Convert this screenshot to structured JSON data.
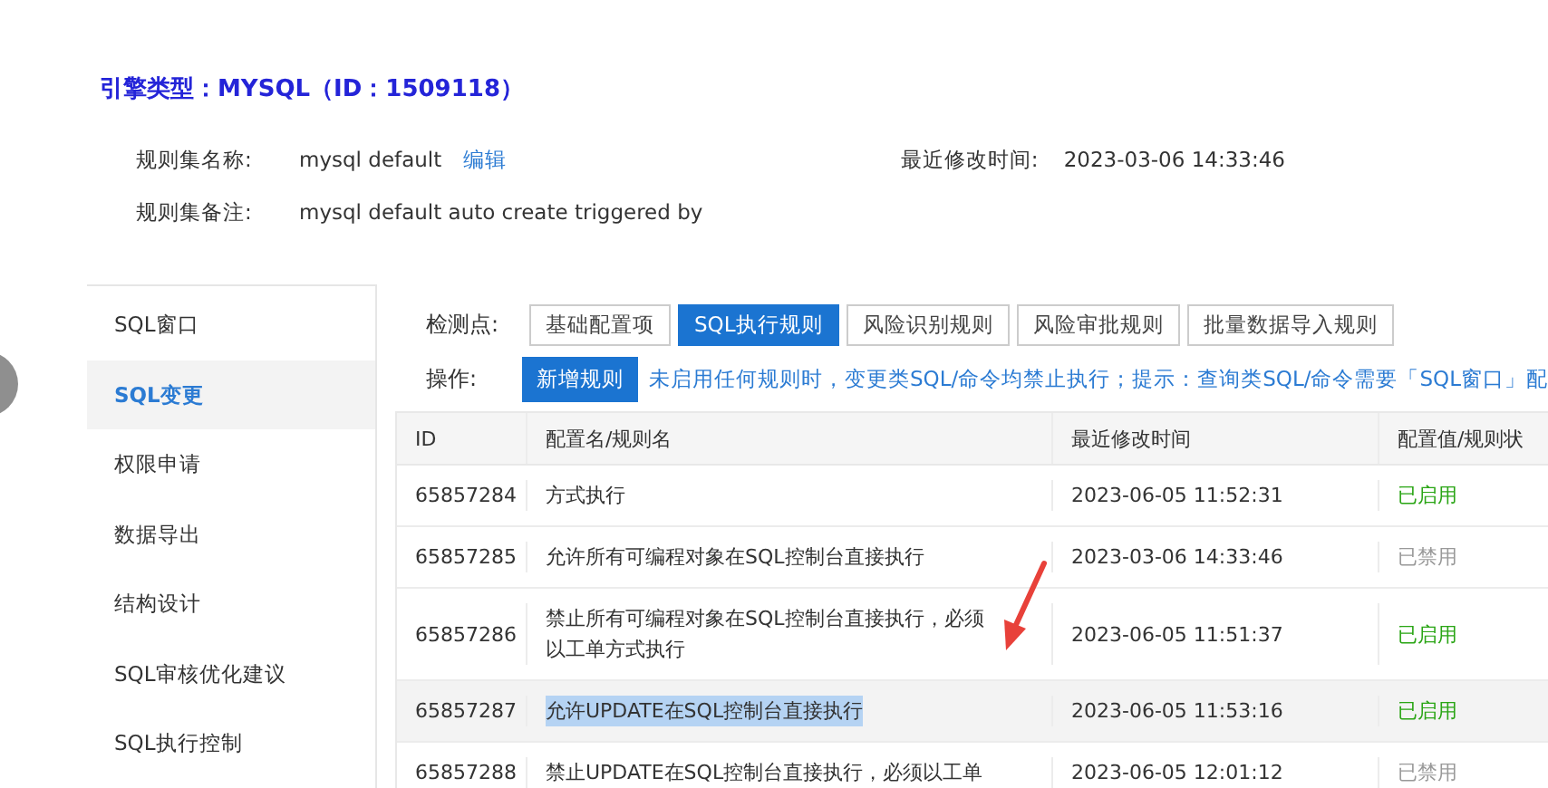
{
  "header": {
    "title": "引擎类型：MYSQL（ID：1509118）"
  },
  "info": [
    {
      "label": "规则集名称:",
      "value": "mysql default",
      "link": "编辑",
      "extra_label": "最近修改时间:",
      "extra_value": "2023-03-06 14:33:46"
    },
    {
      "label": "规则集备注:",
      "value": "mysql default auto create triggered by"
    }
  ],
  "sidebar": {
    "items": [
      {
        "label": "SQL窗口",
        "selected": false
      },
      {
        "label": "SQL变更",
        "selected": true
      },
      {
        "label": "权限申请",
        "selected": false
      },
      {
        "label": "数据导出",
        "selected": false
      },
      {
        "label": "结构设计",
        "selected": false
      },
      {
        "label": "SQL审核优化建议",
        "selected": false
      },
      {
        "label": "SQL执行控制",
        "selected": false
      }
    ]
  },
  "checkpoints": {
    "label": "检测点:",
    "tabs": [
      {
        "label": "基础配置项",
        "selected": false
      },
      {
        "label": "SQL执行规则",
        "selected": true
      },
      {
        "label": "风险识别规则",
        "selected": false
      },
      {
        "label": "风险审批规则",
        "selected": false
      },
      {
        "label": "批量数据导入规则",
        "selected": false
      }
    ]
  },
  "operations": {
    "label": "操作:",
    "button": "新增规则",
    "hint": "未启用任何规则时，变更类SQL/命令均禁止执行；提示：查询类SQL/命令需要「SQL窗口」配"
  },
  "table": {
    "columns": [
      "ID",
      "配置名/规则名",
      "最近修改时间",
      "配置值/规则状"
    ],
    "rows": [
      {
        "id": "65857284",
        "name": "方式执行",
        "time": "2023-06-05 11:52:31",
        "status": "已启用",
        "enabled": true,
        "highlighted": false
      },
      {
        "id": "65857285",
        "name": "允许所有可编程对象在SQL控制台直接执行",
        "time": "2023-03-06 14:33:46",
        "status": "已禁用",
        "enabled": false,
        "highlighted": false
      },
      {
        "id": "65857286",
        "name": "禁止所有可编程对象在SQL控制台直接执行，必须以工单方式执行",
        "time": "2023-06-05 11:51:37",
        "status": "已启用",
        "enabled": true,
        "highlighted": false
      },
      {
        "id": "65857287",
        "name": "允许UPDATE在SQL控制台直接执行",
        "time": "2023-06-05 11:53:16",
        "status": "已启用",
        "enabled": true,
        "highlighted": true
      },
      {
        "id": "65857288",
        "name": "禁止UPDATE在SQL控制台直接执行，必须以工单",
        "time": "2023-06-05 12:01:12",
        "status": "已禁用",
        "enabled": false,
        "highlighted": false
      }
    ]
  }
}
